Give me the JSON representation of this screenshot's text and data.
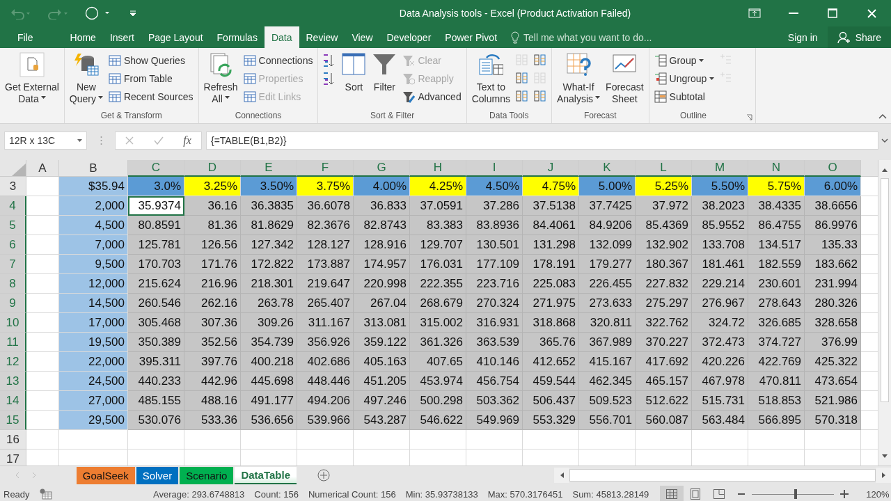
{
  "window": {
    "title": "Data Analysis tools - Excel (Product Activation Failed)"
  },
  "menu_tabs": [
    {
      "label": "File",
      "selected": false
    },
    {
      "label": "Home",
      "selected": false
    },
    {
      "label": "Insert",
      "selected": false
    },
    {
      "label": "Page Layout",
      "selected": false
    },
    {
      "label": "Formulas",
      "selected": false
    },
    {
      "label": "Data",
      "selected": true
    },
    {
      "label": "Review",
      "selected": false
    },
    {
      "label": "View",
      "selected": false
    },
    {
      "label": "Developer",
      "selected": false
    },
    {
      "label": "Power Pivot",
      "selected": false
    }
  ],
  "tell_me": {
    "placeholder": "Tell me what you want to do..."
  },
  "sign_in": "Sign in",
  "share": "Share",
  "ribbon": {
    "groups": [
      {
        "items": [
          {
            "kind": "large",
            "lines": [
              "Get External",
              "Data"
            ],
            "dropdown": true
          }
        ]
      },
      {
        "label": "Get & Transform",
        "items": [
          {
            "kind": "large",
            "lines": [
              "New",
              "Query"
            ],
            "dropdown": true
          },
          {
            "kind": "small",
            "label": "Show Queries",
            "disabled": false
          },
          {
            "kind": "small",
            "label": "From Table",
            "disabled": false
          },
          {
            "kind": "small",
            "label": "Recent Sources",
            "disabled": false
          }
        ]
      },
      {
        "label": "Connections",
        "items": [
          {
            "kind": "large",
            "lines": [
              "Refresh",
              "All"
            ],
            "dropdown": true
          },
          {
            "kind": "small",
            "label": "Connections",
            "disabled": false
          },
          {
            "kind": "small",
            "label": "Properties",
            "disabled": true
          },
          {
            "kind": "small",
            "label": "Edit Links",
            "disabled": true
          }
        ]
      },
      {
        "label": "Sort & Filter",
        "items": [
          {
            "kind": "icon",
            "disabled": false
          },
          {
            "kind": "icon",
            "disabled": false
          },
          {
            "kind": "large",
            "lines": [
              "Sort"
            ],
            "dropdown": false
          },
          {
            "kind": "large",
            "lines": [
              "Filter"
            ],
            "dropdown": false
          },
          {
            "kind": "small",
            "label": "Clear",
            "disabled": true
          },
          {
            "kind": "small",
            "label": "Reapply",
            "disabled": true
          },
          {
            "kind": "small",
            "label": "Advanced",
            "disabled": false
          }
        ]
      },
      {
        "label": "Data Tools",
        "items": [
          {
            "kind": "large",
            "lines": [
              "Text to",
              "Columns"
            ],
            "dropdown": false
          },
          {
            "kind": "icon",
            "disabled": true
          },
          {
            "kind": "icon",
            "disabled": false
          },
          {
            "kind": "icon",
            "disabled": false
          },
          {
            "kind": "icon",
            "disabled": false
          },
          {
            "kind": "icon",
            "disabled": true
          },
          {
            "kind": "icon",
            "disabled": false
          }
        ]
      },
      {
        "label": "Forecast",
        "items": [
          {
            "kind": "large",
            "lines": [
              "What-If",
              "Analysis"
            ],
            "dropdown": true
          },
          {
            "kind": "large",
            "lines": [
              "Forecast",
              "Sheet"
            ],
            "dropdown": false
          }
        ]
      },
      {
        "label": "Outline",
        "items": [
          {
            "kind": "small",
            "label": "Group",
            "disabled": false,
            "dropdown": true
          },
          {
            "kind": "small",
            "label": "Ungroup",
            "disabled": false,
            "dropdown": true
          },
          {
            "kind": "small",
            "label": "Subtotal",
            "disabled": false
          },
          {
            "kind": "icon",
            "disabled": true
          },
          {
            "kind": "icon",
            "disabled": true
          }
        ]
      }
    ]
  },
  "formula_bar": {
    "name_box": "12R x 13C",
    "function_label": "fx",
    "formula": "{=TABLE(B1,B2)}"
  },
  "sheet": {
    "columns": [
      {
        "label": "A",
        "selected": false
      },
      {
        "label": "B",
        "selected": false
      },
      {
        "label": "C",
        "selected": true
      },
      {
        "label": "D",
        "selected": true
      },
      {
        "label": "E",
        "selected": true
      },
      {
        "label": "F",
        "selected": true
      },
      {
        "label": "G",
        "selected": true
      },
      {
        "label": "H",
        "selected": true
      },
      {
        "label": "I",
        "selected": true
      },
      {
        "label": "J",
        "selected": true
      },
      {
        "label": "K",
        "selected": true
      },
      {
        "label": "L",
        "selected": true
      },
      {
        "label": "M",
        "selected": true
      },
      {
        "label": "N",
        "selected": true
      },
      {
        "label": "O",
        "selected": true
      }
    ],
    "rows": [
      {
        "number": "3",
        "selected": false,
        "b": "$35.94",
        "headers": [
          {
            "text": "3.0%",
            "color": "#5b9bd5"
          },
          {
            "text": "3.25%",
            "color": "#ffff00"
          },
          {
            "text": "3.50%",
            "color": "#5b9bd5"
          },
          {
            "text": "3.75%",
            "color": "#ffff00"
          },
          {
            "text": "4.00%",
            "color": "#5b9bd5"
          },
          {
            "text": "4.25%",
            "color": "#ffff00"
          },
          {
            "text": "4.50%",
            "color": "#5b9bd5"
          },
          {
            "text": "4.75%",
            "color": "#ffff00"
          },
          {
            "text": "5.00%",
            "color": "#5b9bd5"
          },
          {
            "text": "5.25%",
            "color": "#ffff00"
          },
          {
            "text": "5.50%",
            "color": "#5b9bd5"
          },
          {
            "text": "5.75%",
            "color": "#ffff00"
          },
          {
            "text": "6.00%",
            "color": "#5b9bd5"
          }
        ]
      },
      {
        "number": "4",
        "selected": true,
        "first_cell_active": true,
        "b": "2,000",
        "values": [
          "35.9374",
          "36.16",
          "36.3835",
          "36.6078",
          "36.833",
          "37.0591",
          "37.286",
          "37.5138",
          "37.7425",
          "37.972",
          "38.2023",
          "38.4335",
          "38.6656"
        ]
      },
      {
        "number": "5",
        "selected": true,
        "first_cell_active": false,
        "b": "4,500",
        "values": [
          "80.8591",
          "81.36",
          "81.8629",
          "82.3676",
          "82.8743",
          "83.383",
          "83.8936",
          "84.4061",
          "84.9206",
          "85.4369",
          "85.9552",
          "86.4755",
          "86.9976"
        ]
      },
      {
        "number": "6",
        "selected": true,
        "first_cell_active": false,
        "b": "7,000",
        "values": [
          "125.781",
          "126.56",
          "127.342",
          "128.127",
          "128.916",
          "129.707",
          "130.501",
          "131.298",
          "132.099",
          "132.902",
          "133.708",
          "134.517",
          "135.33"
        ]
      },
      {
        "number": "7",
        "selected": true,
        "first_cell_active": false,
        "b": "9,500",
        "values": [
          "170.703",
          "171.76",
          "172.822",
          "173.887",
          "174.957",
          "176.031",
          "177.109",
          "178.191",
          "179.277",
          "180.367",
          "181.461",
          "182.559",
          "183.662"
        ]
      },
      {
        "number": "8",
        "selected": true,
        "first_cell_active": false,
        "b": "12,000",
        "values": [
          "215.624",
          "216.96",
          "218.301",
          "219.647",
          "220.998",
          "222.355",
          "223.716",
          "225.083",
          "226.455",
          "227.832",
          "229.214",
          "230.601",
          "231.994"
        ]
      },
      {
        "number": "9",
        "selected": true,
        "first_cell_active": false,
        "b": "14,500",
        "values": [
          "260.546",
          "262.16",
          "263.78",
          "265.407",
          "267.04",
          "268.679",
          "270.324",
          "271.975",
          "273.633",
          "275.297",
          "276.967",
          "278.643",
          "280.326"
        ]
      },
      {
        "number": "10",
        "selected": true,
        "first_cell_active": false,
        "b": "17,000",
        "values": [
          "305.468",
          "307.36",
          "309.26",
          "311.167",
          "313.081",
          "315.002",
          "316.931",
          "318.868",
          "320.811",
          "322.762",
          "324.72",
          "326.685",
          "328.658"
        ]
      },
      {
        "number": "11",
        "selected": true,
        "first_cell_active": false,
        "b": "19,500",
        "values": [
          "350.389",
          "352.56",
          "354.739",
          "356.926",
          "359.122",
          "361.326",
          "363.539",
          "365.76",
          "367.989",
          "370.227",
          "372.473",
          "374.727",
          "376.99"
        ]
      },
      {
        "number": "12",
        "selected": true,
        "first_cell_active": false,
        "b": "22,000",
        "values": [
          "395.311",
          "397.76",
          "400.218",
          "402.686",
          "405.163",
          "407.65",
          "410.146",
          "412.652",
          "415.167",
          "417.692",
          "420.226",
          "422.769",
          "425.322"
        ]
      },
      {
        "number": "13",
        "selected": true,
        "first_cell_active": false,
        "b": "24,500",
        "values": [
          "440.233",
          "442.96",
          "445.698",
          "448.446",
          "451.205",
          "453.974",
          "456.754",
          "459.544",
          "462.345",
          "465.157",
          "467.978",
          "470.811",
          "473.654"
        ]
      },
      {
        "number": "14",
        "selected": true,
        "first_cell_active": false,
        "b": "27,000",
        "values": [
          "485.155",
          "488.16",
          "491.177",
          "494.206",
          "497.246",
          "500.298",
          "503.362",
          "506.437",
          "509.523",
          "512.622",
          "515.731",
          "518.853",
          "521.986"
        ]
      },
      {
        "number": "15",
        "selected": true,
        "first_cell_active": false,
        "b": "29,500",
        "values": [
          "530.076",
          "533.36",
          "536.656",
          "539.966",
          "543.287",
          "546.622",
          "549.969",
          "553.329",
          "556.701",
          "560.087",
          "563.484",
          "566.895",
          "570.318"
        ]
      },
      {
        "number": "16",
        "selected": false
      },
      {
        "number": "17",
        "selected": false
      }
    ]
  },
  "sheet_tabs": [
    {
      "label": "GoalSeek",
      "color": "#ed7d31",
      "selected": false
    },
    {
      "label": "Solver",
      "color": "#0070c0",
      "selected": false
    },
    {
      "label": "Scenario",
      "color": "#00b050",
      "selected": false
    },
    {
      "label": "DataTable",
      "color": "#217346",
      "selected": true
    }
  ],
  "status_bar": {
    "mode": "Ready",
    "stats": [
      "Average: 293.6748813",
      "Count: 156",
      "Numerical Count: 156",
      "Min: 35.93738133",
      "Max: 570.3176451",
      "Sum: 45813.28149"
    ],
    "views": [
      {
        "selected": true
      },
      {
        "selected": false
      },
      {
        "selected": false
      }
    ],
    "zoom": {
      "level": 0.53,
      "label": "120%"
    }
  }
}
